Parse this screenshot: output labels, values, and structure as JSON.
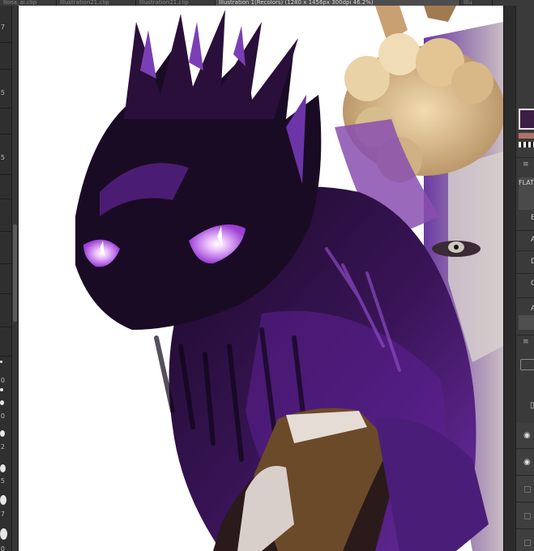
{
  "tabs": [
    {
      "label": "Ilona_ai.clip",
      "active": false
    },
    {
      "label": "Illustration21.clip",
      "active": false
    },
    {
      "label": "Illustration21.clip",
      "active": false
    },
    {
      "label": "Illustration 1(Recolors) (1280 x 1456px 300dpi 46.2%)",
      "active": true
    },
    {
      "label": "Illu",
      "active": false
    }
  ],
  "left_strip": {
    "size_labels": [
      "7",
      "5",
      "5",
      "0",
      "0",
      "2",
      "5",
      "7",
      "0",
      "0"
    ]
  },
  "colors": {
    "main": "#3d1f45",
    "sub": "#b1716a",
    "transparent_swatch": "checker"
  },
  "panel": {
    "menu_glyph": "≡",
    "header_label": "FLAT",
    "rows": [
      "B",
      "A",
      "D",
      "C",
      "A"
    ]
  },
  "layers": [
    {
      "visible": true,
      "icon": "eye-icon"
    },
    {
      "visible": true,
      "icon": "eye-icon"
    },
    {
      "visible": false,
      "icon": "visibility-box"
    },
    {
      "visible": false,
      "icon": "visibility-box"
    },
    {
      "visible": false,
      "icon": "visibility-box"
    }
  ],
  "icons": {
    "eye": "eye-icon",
    "menu": "menu-icon",
    "layer_mask": "layer-mask-icon",
    "lock": "lock-icon"
  }
}
